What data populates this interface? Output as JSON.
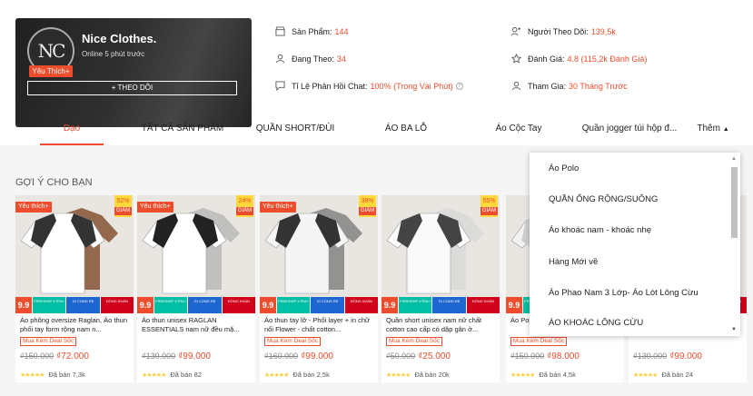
{
  "shop": {
    "name": "Nice Clothes.",
    "status": "Online 5 phút trước",
    "favorite_label": "Yêu Thích+",
    "follow_label": "+ THEO DÕI",
    "logo_text": "NC"
  },
  "stats": [
    {
      "icon": "store-icon",
      "label": "Sản Phẩm:",
      "value": "144"
    },
    {
      "icon": "followers-icon",
      "label": "Người Theo Dõi:",
      "value": "139,5k"
    },
    {
      "icon": "following-icon",
      "label": "Đang Theo:",
      "value": "34"
    },
    {
      "icon": "star-outline-icon",
      "label": "Đánh Giá:",
      "value": "4.8 (115,2k Đánh Giá)"
    },
    {
      "icon": "chat-icon",
      "label": "Tỉ Lệ Phản Hồi Chat:",
      "value": "100% (Trong Vài Phút)"
    },
    {
      "icon": "user-join-icon",
      "label": "Tham Gia:",
      "value": "30 Tháng Trước"
    }
  ],
  "nav": {
    "tabs": [
      "Dạo",
      "TẤT CẢ SẢN PHẨM",
      "QUẦN SHORT/ĐÙI",
      "ÁO BA LỖ",
      "Áo Cộc Tay",
      "Quần jogger túi hộp đ..."
    ],
    "more_label": "Thêm"
  },
  "section_title": "GỢI Ý CHO BẠN",
  "badges": {
    "nine": "9.9",
    "freeship": "FREESHIP XTRA+",
    "cashback": "GI CÙNG RE",
    "genuine": "ĐỒNG KHÁN"
  },
  "products": [
    {
      "fav": "Yêu thích+",
      "discount": "52%",
      "discount_label": "GIẢM",
      "name": "Áo phông oversize Raglan, Áo thun phối tay form rộng nam n...",
      "deal": "Mua Kèm Deal Sốc",
      "old_price": "₫150.000",
      "price": "₫72.000",
      "sold": "Đã bán 7,3k"
    },
    {
      "fav": "Yêu thích+",
      "discount": "24%",
      "discount_label": "GIẢM",
      "name": "Áo thun unisex RAGLAN ESSENTIALS nam nữ đều mặ...",
      "deal": "",
      "old_price": "₫130.000",
      "price": "₫99.000",
      "sold": "Đã bán 82"
    },
    {
      "fav": "Yêu thích+",
      "discount": "38%",
      "discount_label": "GIẢM",
      "name": "Áo thun tay lỡ - Phối layer + in chữ nổi Flower - chất cotton...",
      "deal": "Mua Kèm Deal Sốc",
      "old_price": "₫160.000",
      "price": "₫99.000",
      "sold": "Đã bán 2,5k"
    },
    {
      "fav": "",
      "discount": "55%",
      "discount_label": "GIẢM",
      "name": "Quần short unisex nam nữ chất cotton cao cấp có dập gân ở...",
      "deal": "Mua Kèm Deal Sốc",
      "old_price": "₫50.000",
      "price": "₫25.000",
      "sold": "Đã bán 20k"
    },
    {
      "fav": "",
      "discount": "",
      "discount_label": "",
      "name": "Áo Polo nam phối cổ chất...",
      "deal": "Mua Kèm Deal Sốc",
      "old_price": "₫150.000",
      "price": "₫98.000",
      "sold": "Đã bán 4,5k"
    },
    {
      "fav": "",
      "discount": "",
      "discount_label": "",
      "name": "",
      "deal": "",
      "old_price": "₫130.000",
      "price": "₫99.000",
      "sold": "Đã bán 24"
    }
  ],
  "dropdown": {
    "items": [
      "Áo Polo",
      "QUẦN ỐNG RỘNG/SUÔNG",
      "Áo khoác nam - khoác nhẹ",
      "Hàng Mới về",
      "Áo Phao Nam 3 Lớp- Áo Lót Lông Cừu",
      "ÁO KHOÁC LÔNG CỪU"
    ]
  },
  "colors": {
    "accent": "#ee4d2d",
    "star": "#ffce3d"
  }
}
